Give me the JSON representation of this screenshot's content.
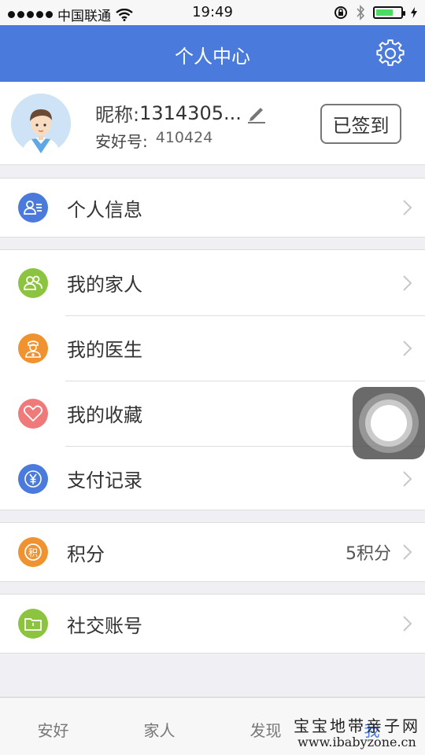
{
  "status_bar": {
    "carrier": "中国联通",
    "time": "19:49"
  },
  "header": {
    "title": "个人中心",
    "settings_icon": "gear-icon"
  },
  "profile": {
    "nickname_label": "昵称:",
    "nickname": "1314305...",
    "id_label": "安好号:",
    "id_value": "410424",
    "signin_label": "已签到"
  },
  "menu": {
    "personal_info": "个人信息",
    "my_family": "我的家人",
    "my_doctor": "我的医生",
    "my_favorites": "我的收藏",
    "payment_records": "支付记录",
    "points": "积分",
    "points_value": "5积分",
    "social_accounts": "社交账号"
  },
  "colors": {
    "accent": "#4a7bdc",
    "green": "#8cc43f",
    "orange": "#f0922f",
    "red": "#f07a7a",
    "blue": "#4a7bdc"
  },
  "tab_bar": {
    "tabs": [
      "安好",
      "家人",
      "发现",
      "我"
    ]
  },
  "watermark": {
    "line1": "宝宝地带亲子网",
    "line2": "www.ibabyzone.cn"
  }
}
